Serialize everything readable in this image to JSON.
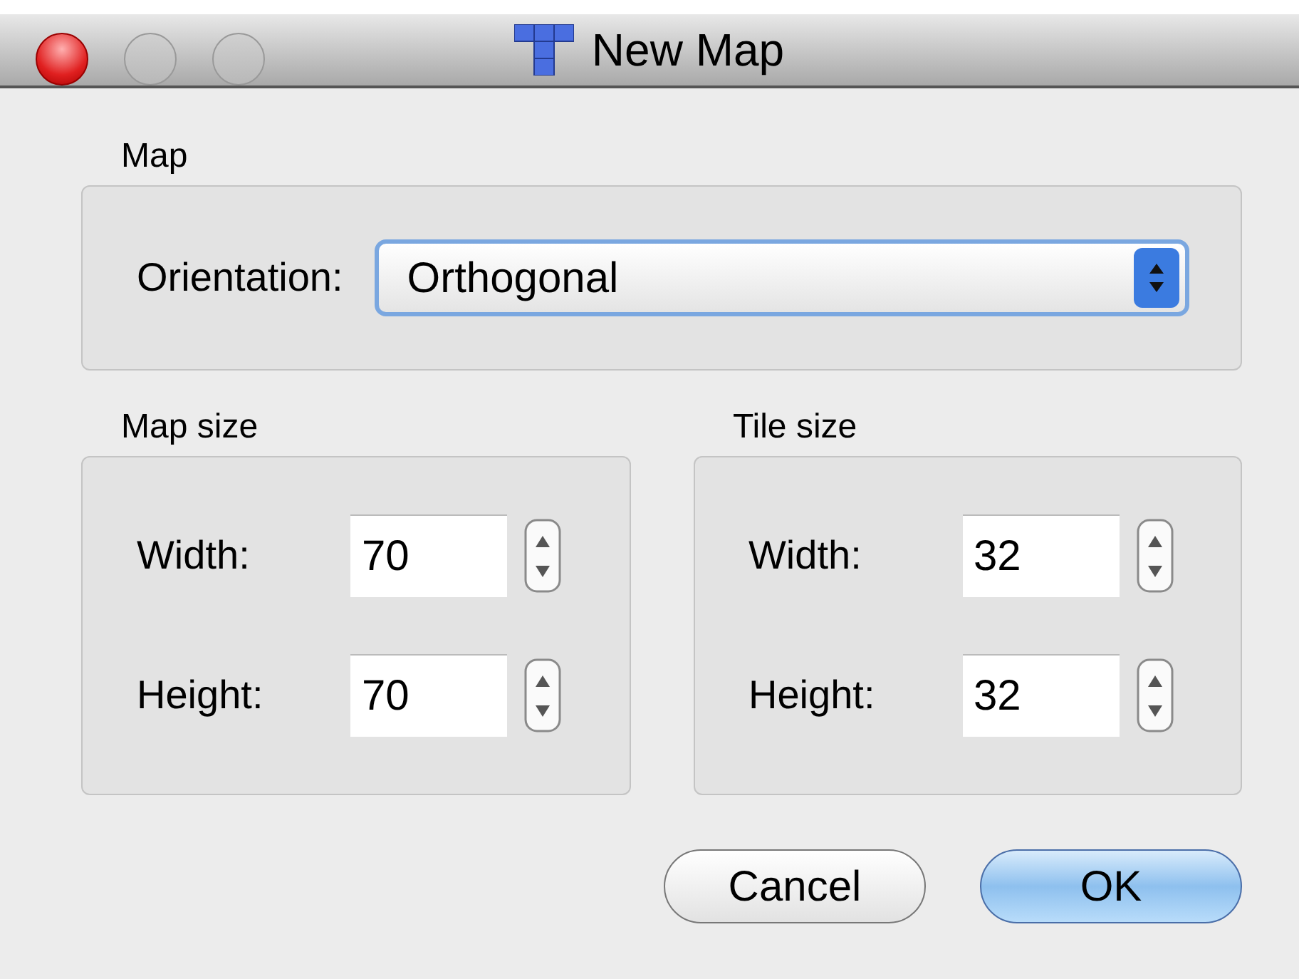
{
  "window": {
    "title": "New Map"
  },
  "map_group": {
    "title": "Map",
    "orientation": {
      "label": "Orientation:",
      "value": "Orthogonal"
    }
  },
  "size_groups": [
    {
      "title": "Map size",
      "fields": [
        {
          "label": "Width:",
          "value": "70"
        },
        {
          "label": "Height:",
          "value": "70"
        }
      ]
    },
    {
      "title": "Tile size",
      "fields": [
        {
          "label": "Width:",
          "value": "32"
        },
        {
          "label": "Height:",
          "value": "32"
        }
      ]
    }
  ],
  "buttons": [
    {
      "label": "Cancel",
      "kind": "normal"
    },
    {
      "label": "OK",
      "kind": "default"
    }
  ]
}
